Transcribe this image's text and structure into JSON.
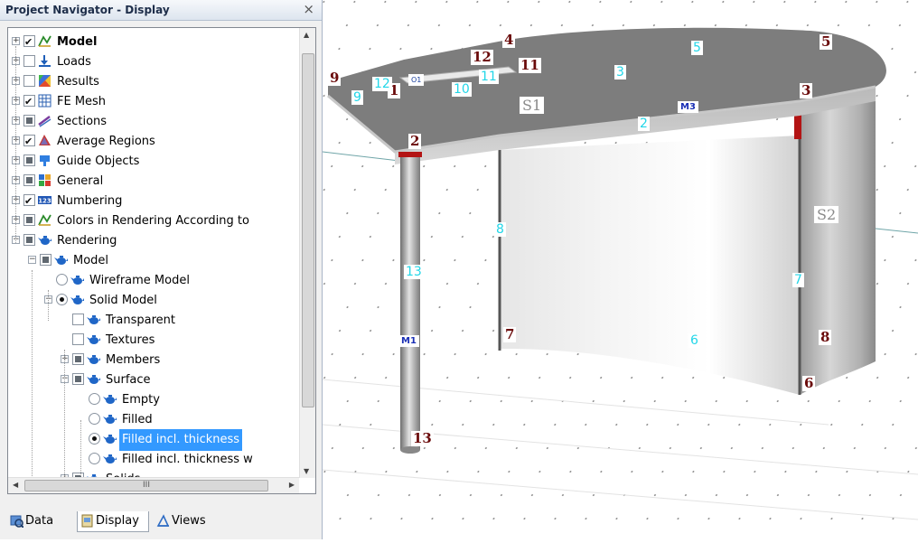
{
  "navigator": {
    "title": "Project Navigator - Display",
    "close_glyph": "×",
    "items": [
      {
        "label": "Model",
        "check": "checked",
        "icon": "model-icon",
        "bold": true
      },
      {
        "label": "Loads",
        "check": "unchecked",
        "icon": "loads-icon"
      },
      {
        "label": "Results",
        "check": "unchecked",
        "icon": "results-icon"
      },
      {
        "label": "FE Mesh",
        "check": "checked",
        "icon": "fe-mesh-icon"
      },
      {
        "label": "Sections",
        "check": "partial",
        "icon": "sections-icon"
      },
      {
        "label": "Average Regions",
        "check": "checked",
        "icon": "average-regions-icon"
      },
      {
        "label": "Guide Objects",
        "check": "partial",
        "icon": "guide-objects-icon"
      },
      {
        "label": "General",
        "check": "partial",
        "icon": "general-icon"
      },
      {
        "label": "Numbering",
        "check": "checked",
        "icon": "numbering-icon"
      },
      {
        "label": "Colors in Rendering According to",
        "check": "partial",
        "icon": "colors-icon"
      },
      {
        "label": "Rendering",
        "check": "partial",
        "icon": "rendering-icon"
      },
      {
        "label": "Model",
        "check": "partial",
        "icon": "rendering-icon"
      },
      {
        "label": "Wireframe Model",
        "radio": "off",
        "icon": "rendering-icon"
      },
      {
        "label": "Solid Model",
        "radio": "on",
        "icon": "rendering-icon"
      },
      {
        "label": "Transparent",
        "check": "unchecked",
        "icon": "rendering-icon"
      },
      {
        "label": "Textures",
        "check": "unchecked",
        "icon": "rendering-icon"
      },
      {
        "label": "Members",
        "check": "partial",
        "icon": "rendering-icon"
      },
      {
        "label": "Surface",
        "check": "partial",
        "icon": "rendering-icon"
      },
      {
        "label": "Empty",
        "radio": "off",
        "icon": "rendering-icon"
      },
      {
        "label": "Filled",
        "radio": "off",
        "icon": "rendering-icon"
      },
      {
        "label": "Filled incl. thickness",
        "radio": "on",
        "icon": "rendering-icon",
        "selected": true
      },
      {
        "label": "Filled incl. thickness w",
        "radio": "off",
        "icon": "rendering-icon"
      },
      {
        "label": "Solids",
        "check": "partial",
        "icon": "rendering-icon"
      }
    ],
    "hscroll_thumb": "III",
    "tabs": [
      {
        "label": "Data",
        "icon": "data-tab-icon"
      },
      {
        "label": "Display",
        "icon": "display-tab-icon",
        "active": true
      },
      {
        "label": "Views",
        "icon": "views-tab-icon"
      }
    ]
  },
  "view3d": {
    "node_labels": [
      "9",
      "12",
      "11",
      "4",
      "5",
      "3",
      "2",
      "7",
      "8",
      "6",
      "13",
      "1"
    ],
    "line_labels": [
      "12",
      "11",
      "10",
      "9",
      "3",
      "5",
      "2",
      "8",
      "13",
      "7",
      "6"
    ],
    "surface_labels": [
      "S1",
      "S2"
    ],
    "member_labels": [
      "M1",
      "M3"
    ],
    "opening_label": "O1"
  }
}
